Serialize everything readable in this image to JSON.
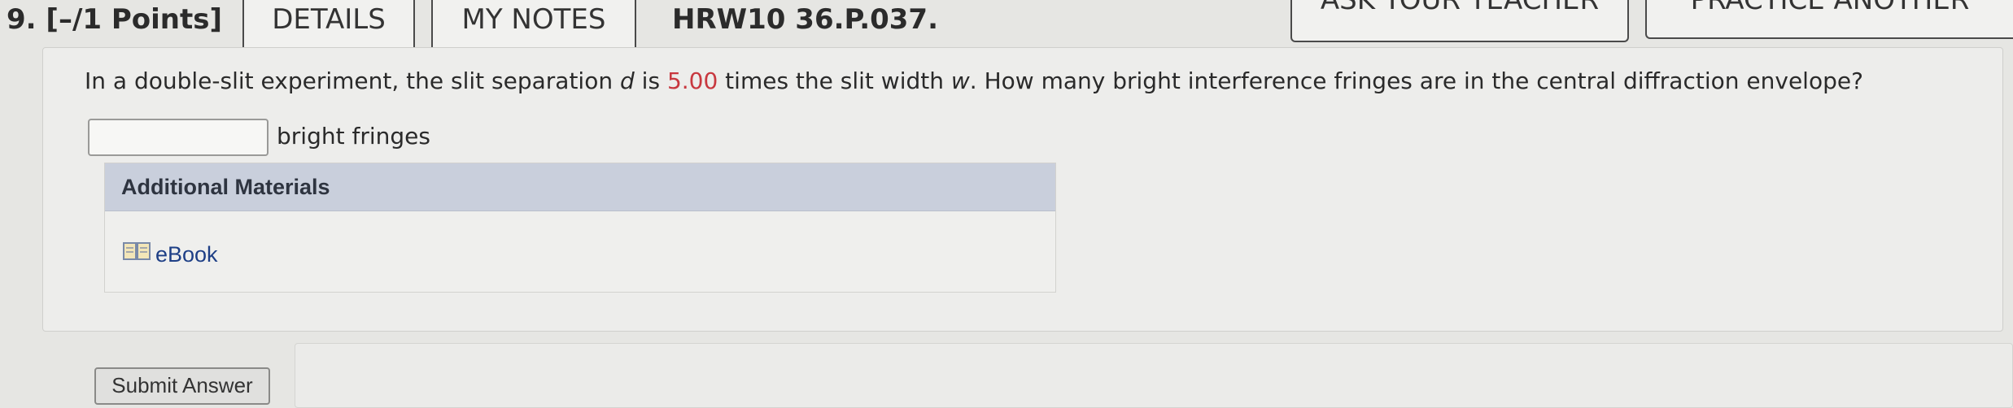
{
  "header": {
    "question_number": "9.",
    "points": "[–/1 Points]",
    "details_label": "DETAILS",
    "my_notes_label": "MY NOTES",
    "question_ref": "HRW10 36.P.037.",
    "ask_teacher_label": "ASK YOUR TEACHER",
    "practice_another_label": "PRACTICE ANOTHER"
  },
  "question": {
    "text_part1": "In a double-slit experiment, the slit separation ",
    "var_d": "d",
    "text_part2": " is ",
    "value": "5.00",
    "text_part3": " times the slit width ",
    "var_w": "w",
    "text_part4": ". How many bright interference fringes are in the central diffraction envelope?",
    "answer_value": "",
    "unit_label": "bright fringes"
  },
  "materials": {
    "title": "Additional Materials",
    "ebook_label": "eBook"
  },
  "footer": {
    "submit_label": "Submit Answer"
  },
  "colors": {
    "highlight_value": "#c8383f",
    "link": "#1e3f86",
    "materials_header_bg": "#c9cfdc"
  }
}
